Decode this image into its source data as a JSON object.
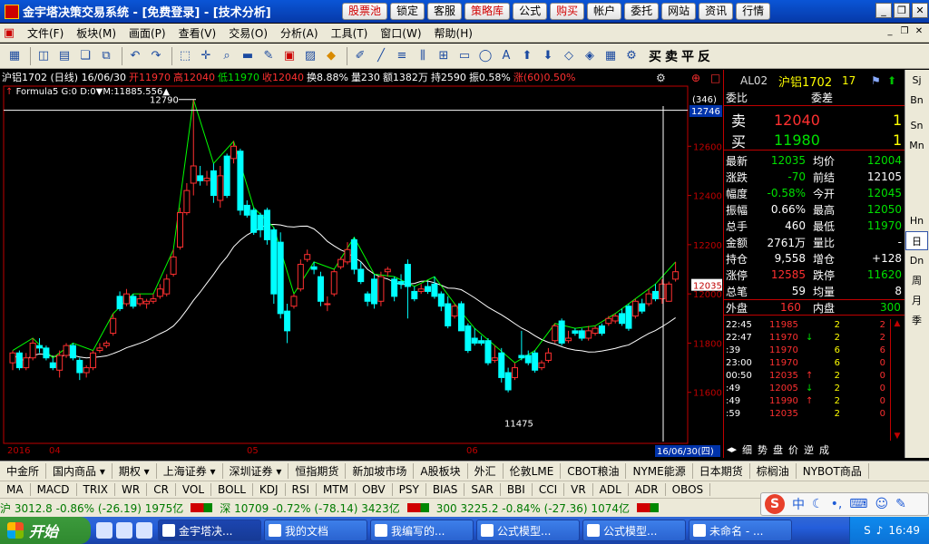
{
  "titlebar": {
    "title": "金宇塔决策交易系统 - [免费登录] - [技术分析]",
    "buttons": [
      "股票池",
      "锁定",
      "客服",
      "策略库",
      "公式",
      "购买",
      "帐户",
      "委托",
      "网站",
      "资讯",
      "行情"
    ]
  },
  "menubar": {
    "items": [
      "文件(F)",
      "板块(M)",
      "画面(P)",
      "查看(V)",
      "交易(O)",
      "分析(A)",
      "工具(T)",
      "窗口(W)",
      "帮助(H)"
    ]
  },
  "toolbar": {
    "right_chars": "买卖平反"
  },
  "chart": {
    "info": {
      "symbol": "沪铝1702 (日线) 16/06/30",
      "open": "开11970",
      "high": "高12040",
      "low": "低11970",
      "close": "收12040",
      "turnover_rate": "换8.88%",
      "volume": "量230",
      "amount": "额1382万",
      "position": "持2590",
      "amplitude": "振0.58%",
      "change": "涨(60)0.50%"
    },
    "formula": "Formula5 G:0 D:0▼M:11885.556▲",
    "labels": {
      "high_mark": "12790",
      "low_mark": "11475",
      "top_right_count": "(346)",
      "top_right_price": "12746",
      "last_price_tag": "12035",
      "cursor_date": "16/06/30(四)"
    },
    "xlabels": [
      "2016",
      "04",
      "05",
      "06"
    ]
  },
  "chart_data": {
    "type": "candlestick",
    "title": "沪铝1702 (日线)",
    "y_ticks": [
      11600,
      11800,
      12000,
      12200,
      12400,
      12600
    ],
    "ylim": [
      11400,
      12800
    ],
    "x_ticks": [
      "2016",
      "04",
      "05",
      "06"
    ],
    "annotations": [
      "12790",
      "11475"
    ],
    "candles": [
      {
        "o": 11720,
        "c": 11760,
        "h": 11770,
        "l": 11690
      },
      {
        "o": 11760,
        "c": 11700,
        "h": 11770,
        "l": 11690
      },
      {
        "o": 11700,
        "c": 11740,
        "h": 11760,
        "l": 11690
      },
      {
        "o": 11740,
        "c": 11800,
        "h": 11820,
        "l": 11730
      },
      {
        "o": 11790,
        "c": 11780,
        "h": 11820,
        "l": 11760
      },
      {
        "o": 11780,
        "c": 11740,
        "h": 11790,
        "l": 11730
      },
      {
        "o": 11720,
        "c": 11700,
        "h": 11740,
        "l": 11690
      },
      {
        "o": 11690,
        "c": 11750,
        "h": 11770,
        "l": 11660
      },
      {
        "o": 11750,
        "c": 11790,
        "h": 11800,
        "l": 11740
      },
      {
        "o": 11790,
        "c": 11740,
        "h": 11800,
        "l": 11730
      },
      {
        "o": 11730,
        "c": 11680,
        "h": 11740,
        "l": 11650
      },
      {
        "o": 11680,
        "c": 11700,
        "h": 11710,
        "l": 11660
      },
      {
        "o": 11700,
        "c": 11760,
        "h": 11770,
        "l": 11690
      },
      {
        "o": 11770,
        "c": 11780,
        "h": 11800,
        "l": 11760
      },
      {
        "o": 11790,
        "c": 11800,
        "h": 11810,
        "l": 11780
      },
      {
        "o": 11840,
        "c": 11900,
        "h": 11920,
        "l": 11830
      },
      {
        "o": 11990,
        "c": 11940,
        "h": 12010,
        "l": 11930
      },
      {
        "o": 11960,
        "c": 12000,
        "h": 12020,
        "l": 11950
      },
      {
        "o": 11990,
        "c": 11950,
        "h": 12000,
        "l": 11940
      },
      {
        "o": 11960,
        "c": 11980,
        "h": 12000,
        "l": 11950
      },
      {
        "o": 11960,
        "c": 11970,
        "h": 11980,
        "l": 11940
      },
      {
        "o": 11970,
        "c": 11980,
        "h": 12000,
        "l": 11960
      },
      {
        "o": 11990,
        "c": 12020,
        "h": 12040,
        "l": 11980
      },
      {
        "o": 12000,
        "c": 12060,
        "h": 12080,
        "l": 11990
      },
      {
        "o": 12080,
        "c": 12150,
        "h": 12180,
        "l": 12070
      },
      {
        "o": 12190,
        "c": 12330,
        "h": 12350,
        "l": 12180
      },
      {
        "o": 12330,
        "c": 12420,
        "h": 12450,
        "l": 12320
      },
      {
        "o": 12450,
        "c": 12520,
        "h": 12790,
        "l": 12400
      },
      {
        "o": 12480,
        "c": 12460,
        "h": 12520,
        "l": 12440
      },
      {
        "o": 12460,
        "c": 12470,
        "h": 12500,
        "l": 12440
      },
      {
        "o": 12500,
        "c": 12400,
        "h": 12530,
        "l": 12370
      },
      {
        "o": 12380,
        "c": 12480,
        "h": 12520,
        "l": 12350
      },
      {
        "o": 12560,
        "c": 12400,
        "h": 12570,
        "l": 12390
      },
      {
        "o": 12550,
        "c": 12600,
        "h": 12620,
        "l": 12530
      },
      {
        "o": 12580,
        "c": 12340,
        "h": 12590,
        "l": 12320
      },
      {
        "o": 12360,
        "c": 12320,
        "h": 12380,
        "l": 12310
      },
      {
        "o": 12340,
        "c": 12250,
        "h": 12350,
        "l": 12240
      },
      {
        "o": 12320,
        "c": 12260,
        "h": 12330,
        "l": 12230
      },
      {
        "o": 12340,
        "c": 12220,
        "h": 12350,
        "l": 12200
      },
      {
        "o": 12260,
        "c": 12000,
        "h": 12270,
        "l": 11960
      },
      {
        "o": 12210,
        "c": 11920,
        "h": 12250,
        "l": 11900
      },
      {
        "o": 11930,
        "c": 11850,
        "h": 11960,
        "l": 11800
      },
      {
        "o": 11950,
        "c": 11990,
        "h": 12000,
        "l": 11940
      },
      {
        "o": 12020,
        "c": 12120,
        "h": 12140,
        "l": 12010
      },
      {
        "o": 12140,
        "c": 12160,
        "h": 12180,
        "l": 12130
      },
      {
        "o": 12110,
        "c": 12100,
        "h": 12130,
        "l": 12080
      },
      {
        "o": 12070,
        "c": 11970,
        "h": 12090,
        "l": 11950
      },
      {
        "o": 11960,
        "c": 11960,
        "h": 11990,
        "l": 11930
      },
      {
        "o": 12000,
        "c": 12090,
        "h": 12100,
        "l": 11990
      },
      {
        "o": 12110,
        "c": 12140,
        "h": 12150,
        "l": 12100
      },
      {
        "o": 12130,
        "c": 12180,
        "h": 12210,
        "l": 12120
      },
      {
        "o": 12220,
        "c": 12100,
        "h": 12230,
        "l": 12080
      },
      {
        "o": 12100,
        "c": 12050,
        "h": 12130,
        "l": 12040
      },
      {
        "o": 12000,
        "c": 11970,
        "h": 12010,
        "l": 11950
      },
      {
        "o": 12060,
        "c": 11960,
        "h": 12080,
        "l": 11940
      },
      {
        "o": 11970,
        "c": 12070,
        "h": 12090,
        "l": 11950
      },
      {
        "o": 12090,
        "c": 12100,
        "h": 12110,
        "l": 12070
      },
      {
        "o": 12060,
        "c": 11990,
        "h": 12070,
        "l": 11970
      },
      {
        "o": 12050,
        "c": 12040,
        "h": 12080,
        "l": 12020
      },
      {
        "o": 12120,
        "c": 12030,
        "h": 12140,
        "l": 11900
      },
      {
        "o": 12010,
        "c": 11980,
        "h": 12030,
        "l": 11970
      },
      {
        "o": 12010,
        "c": 12020,
        "h": 12040,
        "l": 12000
      },
      {
        "o": 12030,
        "c": 12010,
        "h": 12050,
        "l": 12000
      },
      {
        "o": 12040,
        "c": 11990,
        "h": 12070,
        "l": 11980
      },
      {
        "o": 12000,
        "c": 11950,
        "h": 12010,
        "l": 11930
      },
      {
        "o": 11960,
        "c": 11870,
        "h": 11990,
        "l": 11860
      },
      {
        "o": 11910,
        "c": 11950,
        "h": 11960,
        "l": 11900
      },
      {
        "o": 11960,
        "c": 11850,
        "h": 11970,
        "l": 11850
      },
      {
        "o": 11870,
        "c": 11770,
        "h": 11880,
        "l": 11760
      },
      {
        "o": 11820,
        "c": 11800,
        "h": 11860,
        "l": 11790
      },
      {
        "o": 11810,
        "c": 11800,
        "h": 11830,
        "l": 11790
      },
      {
        "o": 11810,
        "c": 11720,
        "h": 11820,
        "l": 11710
      },
      {
        "o": 11730,
        "c": 11740,
        "h": 11790,
        "l": 11720
      },
      {
        "o": 11760,
        "c": 11660,
        "h": 11780,
        "l": 11640
      },
      {
        "o": 11680,
        "c": 11610,
        "h": 11700,
        "l": 11600
      },
      {
        "o": 11660,
        "c": 11700,
        "h": 11720,
        "l": 11650
      },
      {
        "o": 11750,
        "c": 11740,
        "h": 11850,
        "l": 11730
      },
      {
        "o": 11750,
        "c": 11720,
        "h": 11770,
        "l": 11710
      },
      {
        "o": 11760,
        "c": 11690,
        "h": 11770,
        "l": 11680
      },
      {
        "o": 11700,
        "c": 11720,
        "h": 11730,
        "l": 11690
      },
      {
        "o": 11730,
        "c": 11760,
        "h": 11780,
        "l": 11720
      },
      {
        "o": 11810,
        "c": 11870,
        "h": 11880,
        "l": 11800
      },
      {
        "o": 11890,
        "c": 11800,
        "h": 11900,
        "l": 11790
      },
      {
        "o": 11810,
        "c": 11820,
        "h": 11850,
        "l": 11800
      },
      {
        "o": 11850,
        "c": 11840,
        "h": 11860,
        "l": 11830
      },
      {
        "o": 11850,
        "c": 11820,
        "h": 11860,
        "l": 11810
      },
      {
        "o": 11820,
        "c": 11850,
        "h": 11870,
        "l": 11810
      },
      {
        "o": 11840,
        "c": 11860,
        "h": 11870,
        "l": 11830
      },
      {
        "o": 11870,
        "c": 11840,
        "h": 11880,
        "l": 11830
      },
      {
        "o": 11880,
        "c": 11900,
        "h": 11910,
        "l": 11870
      },
      {
        "o": 11890,
        "c": 11910,
        "h": 11920,
        "l": 11880
      },
      {
        "o": 11920,
        "c": 11880,
        "h": 11940,
        "l": 11870
      },
      {
        "o": 11950,
        "c": 11860,
        "h": 11960,
        "l": 11850
      },
      {
        "o": 11910,
        "c": 11970,
        "h": 11980,
        "l": 11900
      },
      {
        "o": 11960,
        "c": 11930,
        "h": 11980,
        "l": 11920
      },
      {
        "o": 11960,
        "c": 12000,
        "h": 12020,
        "l": 11950
      },
      {
        "o": 12010,
        "c": 11980,
        "h": 12040,
        "l": 11970
      },
      {
        "o": 11980,
        "c": 12040,
        "h": 12060,
        "l": 11960
      },
      {
        "o": 11970,
        "c": 12040,
        "h": 12050,
        "l": 11970
      },
      {
        "o": 12060,
        "c": 12090,
        "h": 12130,
        "l": 12050
      }
    ]
  },
  "quote": {
    "code": "AL02",
    "name": "沪铝1702",
    "num": "17",
    "header": [
      "委比",
      "委差"
    ],
    "sell_label": "卖",
    "sell_price": "12040",
    "sell_qty": "1",
    "buy_label": "买",
    "buy_price": "11980",
    "buy_qty": "1",
    "rows": [
      [
        "最新",
        "12035",
        "均价",
        "12004"
      ],
      [
        "涨跌",
        "-70",
        "前结",
        "12105"
      ],
      [
        "幅度",
        "-0.58%",
        "今开",
        "12045"
      ],
      [
        "振幅",
        "0.66%",
        "最高",
        "12050"
      ],
      [
        "总手",
        "460",
        "最低",
        "11970"
      ],
      [
        "金额",
        "2761万",
        "量比",
        "-"
      ],
      [
        "持仓",
        "9,558",
        "增仓",
        "+128"
      ],
      [
        "涨停",
        "12585",
        "跌停",
        "11620"
      ],
      [
        "总笔",
        "59",
        "均量",
        "8"
      ]
    ],
    "outer_label": "外盘",
    "outer_value": "160",
    "inner_label": "内盘",
    "inner_value": "300",
    "ticks": [
      [
        "22:45",
        "11985",
        "",
        "2",
        "2"
      ],
      [
        "22:47",
        "11970",
        "↓",
        "2",
        "2"
      ],
      [
        ":39",
        "11970",
        "",
        "6",
        "6"
      ],
      [
        "23:00",
        "11970",
        "",
        "6",
        "0"
      ],
      [
        "00:50",
        "12035",
        "↑",
        "2",
        "0"
      ],
      [
        ":49",
        "12005",
        "↓",
        "2",
        "0"
      ],
      [
        ":49",
        "11990",
        "↑",
        "2",
        "0"
      ],
      [
        ":59",
        "12035",
        "",
        "2",
        "0"
      ]
    ],
    "tabs": [
      "细",
      "势",
      "盘",
      "价",
      "逆",
      "成"
    ]
  },
  "side_buttons": [
    "Sj",
    "Bn",
    "Sn",
    "Mn",
    "Hn",
    "日",
    "Dn",
    "周",
    "月",
    "季"
  ],
  "bar1": [
    "中金所",
    "国内商品 ▾",
    "期权 ▾",
    "上海证券 ▾",
    "深圳证券 ▾",
    "恒指期货",
    "新加坡市场",
    "A股板块",
    "外汇",
    "伦敦LME",
    "CBOT粮油",
    "NYME能源",
    "日本期货",
    "棕榈油",
    "NYBOT商品"
  ],
  "bar2": [
    "MA",
    "MACD",
    "TRIX",
    "WR",
    "CR",
    "VOL",
    "BOLL",
    "KDJ",
    "RSI",
    "MTM",
    "OBV",
    "PSY",
    "BIAS",
    "SAR",
    "BBI",
    "CCI",
    "VR",
    "ADL",
    "ADR",
    "OBOS"
  ],
  "bar3": {
    "sh": "沪 3012.8 -0.86% (-26.19) 1975亿",
    "sz": "深 10709 -0.72% (-78.14) 3423亿",
    "c300": "300 3225.2 -0.84% (-27.36) 1074亿"
  },
  "taskbar": {
    "start": "开始",
    "tasks": [
      "金宇塔决...",
      "我的文档",
      "我编写的...",
      "公式模型...",
      "公式模型...",
      "未命名 - ..."
    ],
    "clock": "16:49"
  },
  "ime": {
    "mode": "中"
  }
}
